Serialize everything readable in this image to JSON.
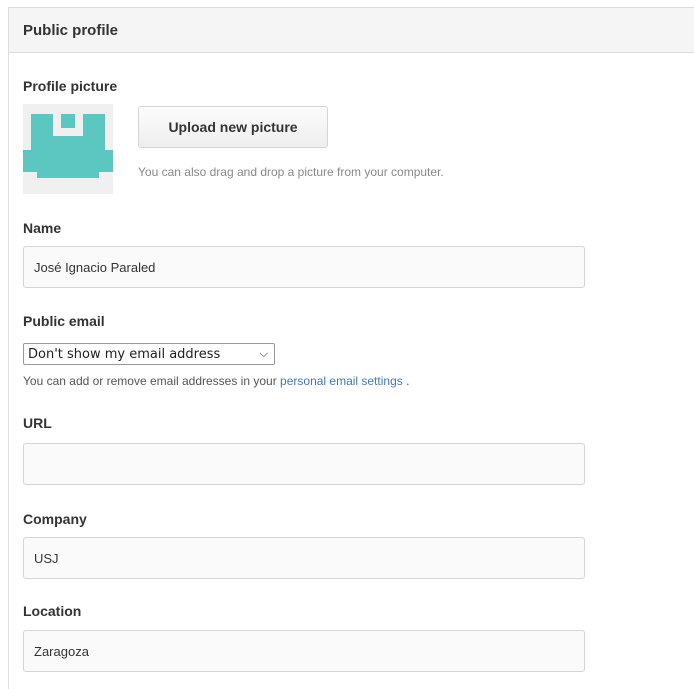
{
  "panel": {
    "title": "Public profile"
  },
  "profile_picture": {
    "label": "Profile picture",
    "upload_button": "Upload new picture",
    "hint": "You can also drag and drop a picture from your computer.",
    "avatar_color": "#5cc6c0"
  },
  "name": {
    "label": "Name",
    "value": "José Ignacio Paraled"
  },
  "public_email": {
    "label": "Public email",
    "selected": "Don't show my email address",
    "hint_prefix": "You can add or remove email addresses in your",
    "hint_link": "personal email settings",
    "hint_suffix": "."
  },
  "url": {
    "label": "URL",
    "value": ""
  },
  "company": {
    "label": "Company",
    "value": "USJ"
  },
  "location": {
    "label": "Location",
    "value": "Zaragoza"
  }
}
